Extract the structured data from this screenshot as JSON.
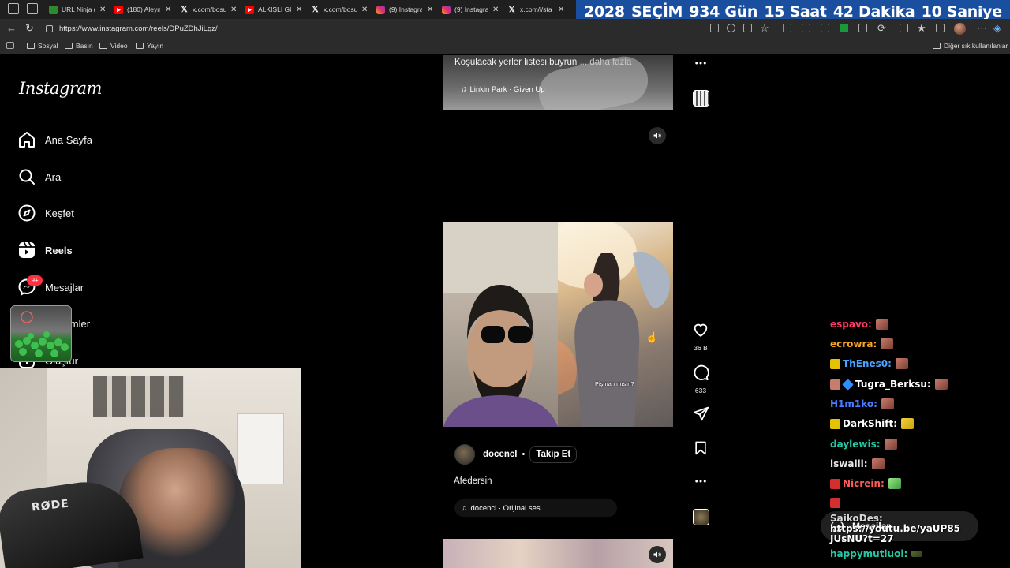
{
  "browser": {
    "tabs": [
      {
        "icon": "url-ninja-icon",
        "title": "URL Ninja (("
      },
      {
        "icon": "youtube-icon",
        "title": "(180) Aleyn"
      },
      {
        "icon": "x-icon",
        "title": "x.com/bosu"
      },
      {
        "icon": "youtube-icon",
        "title": "ALKIŞLI GÜ"
      },
      {
        "icon": "x-icon",
        "title": "x.com/bosu"
      },
      {
        "icon": "instagram-icon",
        "title": "(9) Instagra"
      },
      {
        "icon": "instagram-icon",
        "title": "(9) Instagra"
      },
      {
        "icon": "x-icon",
        "title": "x.com/i/sta"
      }
    ],
    "url": "https://www.instagram.com/reels/DPuZDhJiLgz/",
    "bookmarks": [
      "Sosyal",
      "Basın",
      "Video",
      "Yayın"
    ],
    "other_bookmarks": "Diğer sık kullanılanlar"
  },
  "countdown": {
    "year": "2028",
    "label": "SEÇİM",
    "days": "934 Gün",
    "hours": "15 Saat",
    "minutes": "42 Dakika",
    "seconds": "10 Saniye"
  },
  "instagram": {
    "logo": "Instagram",
    "nav": [
      {
        "label": "Ana Sayfa",
        "icon": "home-icon"
      },
      {
        "label": "Ara",
        "icon": "search-icon"
      },
      {
        "label": "Keşfet",
        "icon": "compass-icon"
      },
      {
        "label": "Reels",
        "icon": "reels-icon"
      },
      {
        "label": "Mesajlar",
        "icon": "messenger-icon"
      },
      {
        "label": "Bildirimler",
        "icon": "heart-icon"
      },
      {
        "label": "Oluştur",
        "icon": "create-icon"
      }
    ],
    "messages_badge": "9+",
    "prev_reel": {
      "caption": "Koşulacak yerler listesi buyrun",
      "more": "... daha fazla",
      "music": "Linkin Park · Given Up"
    },
    "reel": {
      "subtitle": "Pişman mısın?",
      "username": "docencl",
      "follow": "Takip Et",
      "caption": "Afedersin",
      "music": "docencl · Orijinal ses",
      "likes": "36 B",
      "comments": "633"
    }
  },
  "chat": {
    "messages": [
      {
        "user": "espavo:",
        "color": "#ff3b6b",
        "badge": ""
      },
      {
        "user": "ecrowra:",
        "color": "#f5a623",
        "badge": ""
      },
      {
        "user": "ThEnes0:",
        "color": "#4aa3ff",
        "badge": "#e6c300"
      },
      {
        "user": "Tugra_Berksu:",
        "color": "#ffffff",
        "badge": "#2d8fff"
      },
      {
        "user": "H1m1ko:",
        "color": "#4a7dff",
        "badge": ""
      },
      {
        "user": "DarkShift:",
        "color": "#ffffff",
        "badge": "#e6c300"
      },
      {
        "user": "daylewis:",
        "color": "#22c9a4",
        "badge": ""
      },
      {
        "user": "iswaill:",
        "color": "#e8e8e8",
        "badge": ""
      },
      {
        "user": "Nicrein:",
        "color": "#ff5a5a",
        "badge": "#d32f2f"
      }
    ],
    "link_user": "SaikoDes:",
    "link_text": "https://youtu.be/yaUP85",
    "link_text_2": "JUsNU?t=27",
    "last_user": "happymutluol:",
    "last_color": "#22c9a4",
    "messages_pill": "Mesajlar"
  },
  "webcam": {
    "mic_brand": "RØDE"
  }
}
